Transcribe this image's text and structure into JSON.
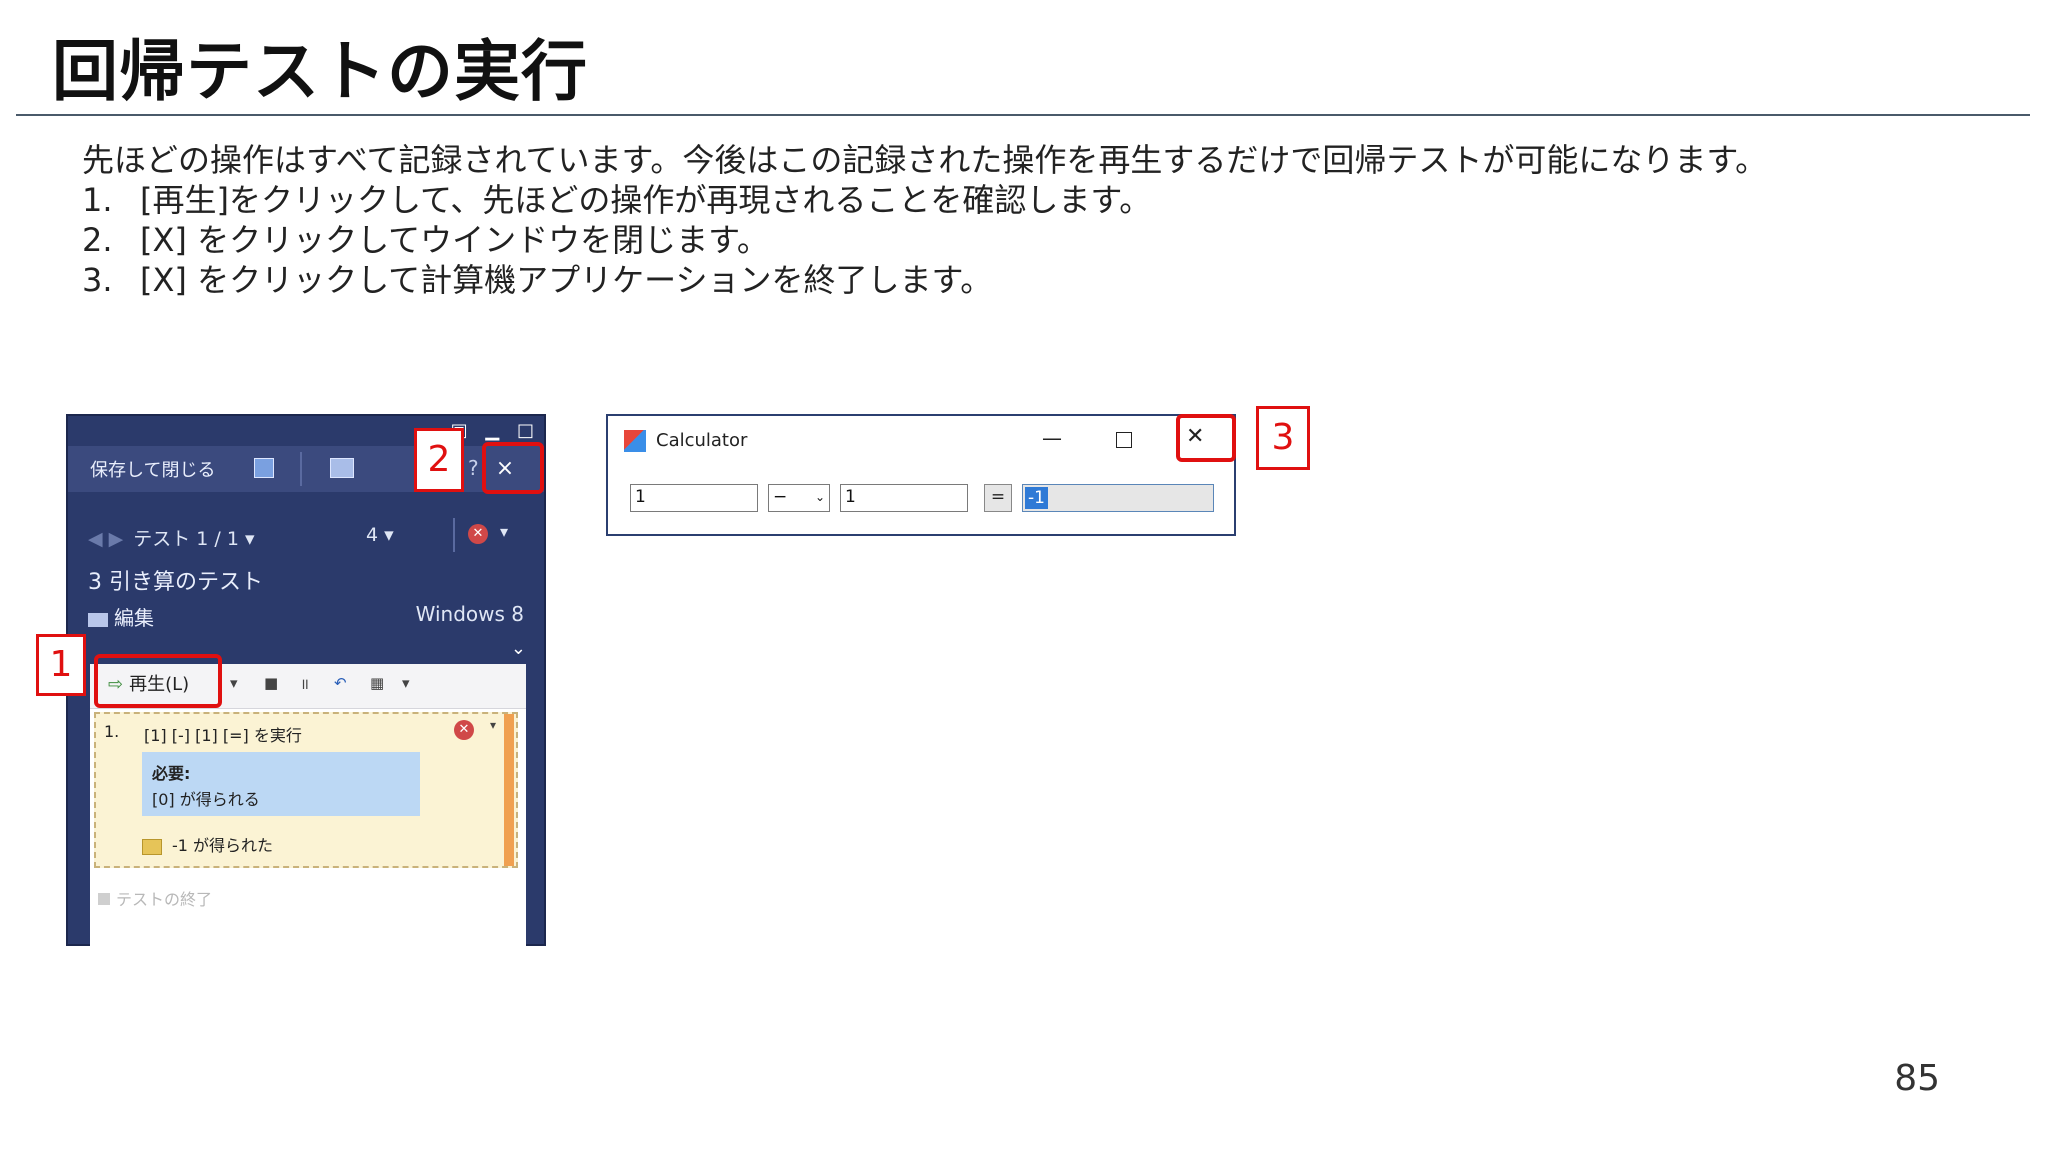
{
  "title": "回帰テストの実行",
  "intro": "先ほどの操作はすべて記録されています。今後はこの記録された操作を再生するだけで回帰テストが可能になります。",
  "steps": [
    {
      "num": "1.",
      "text": "[再生]をクリックして、先ほどの操作が再現されることを確認します。"
    },
    {
      "num": "2.",
      "text": "[X] をクリックしてウインドウを閉じます。"
    },
    {
      "num": "3.",
      "text": "[X] をクリックして計算機アプリケーションを終了します。"
    }
  ],
  "runner": {
    "save_close": "保存して閉じる",
    "nav": "テスト 1 / 1 ▾",
    "attachments": "4 ▾",
    "test_name": "3 引き算のテスト",
    "edit": "編集",
    "os": "Windows 8",
    "play": "再生(L)",
    "step_num": "1.",
    "step_text": "[1] [-] [1] [=] を実行",
    "required_title": "必要:",
    "required_value": "[0] が得られる",
    "result": "-1 が得られた",
    "end": "テストの終了",
    "close_glyph": "×"
  },
  "calculator": {
    "title": "Calculator",
    "input1": "1",
    "operator": "−",
    "input2": "1",
    "equals": "=",
    "result": "-1"
  },
  "callouts": {
    "one": "1",
    "two": "2",
    "three": "3"
  },
  "colors": {
    "callout": "#e01010",
    "runner_bg": "#2b3a6b",
    "step_bg": "#fbf3d4",
    "required_bg": "#bcd8f4"
  },
  "page_number": "85"
}
